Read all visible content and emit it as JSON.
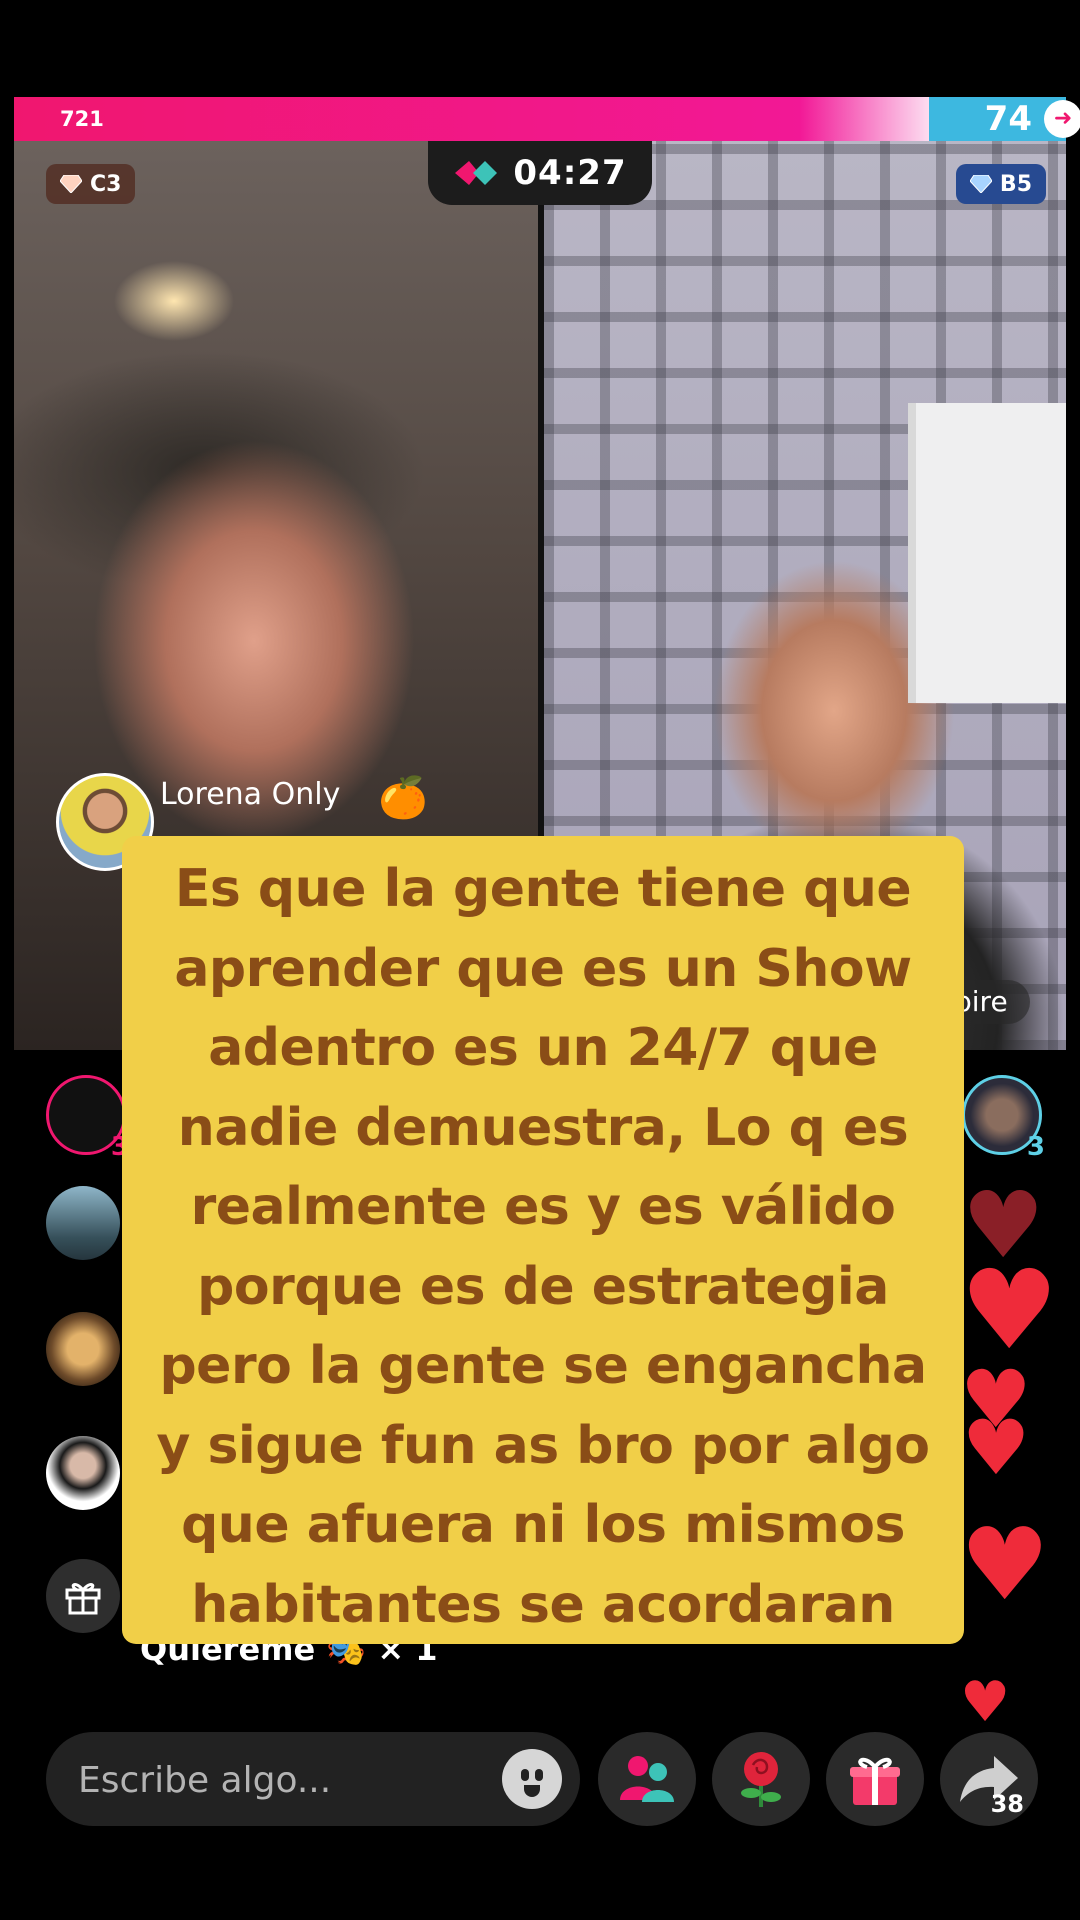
{
  "battle": {
    "left_score": "721",
    "right_score": "74",
    "timer": "04:27",
    "left_rank": "C3",
    "right_rank": "B5"
  },
  "host": {
    "name": "Lorena Only",
    "partner_name_tail": "pire"
  },
  "side": {
    "left_avatar_badge": "3",
    "right_avatar_badge": "3"
  },
  "gift_message": {
    "label": "Quiereme",
    "gift_emoji": "🎭",
    "count": "× 1"
  },
  "caption": {
    "text": "Es que la gente tiene  que\naprender  que es un Show\nadentro es un 24/7 que\nnadie demuestra, Lo q es\nrealmente  es y es válido\nporque es de estrategia\npero la gente se engancha\ny sigue fun as bro por algo\nque afuera ni los mismos\nhabitantes se acordaran"
  },
  "bottom_bar": {
    "input_placeholder": "Escribe algo...",
    "buttons": [
      "emoji-icon",
      "invite-guests-icon",
      "rose-gift-icon",
      "gift-icon",
      "share-icon"
    ],
    "share_count": "38"
  },
  "colors": {
    "left_team": "#f0176f",
    "right_team": "#3db8e0",
    "caption_bg": "#f1cf48",
    "caption_text": "#8a4d17"
  }
}
